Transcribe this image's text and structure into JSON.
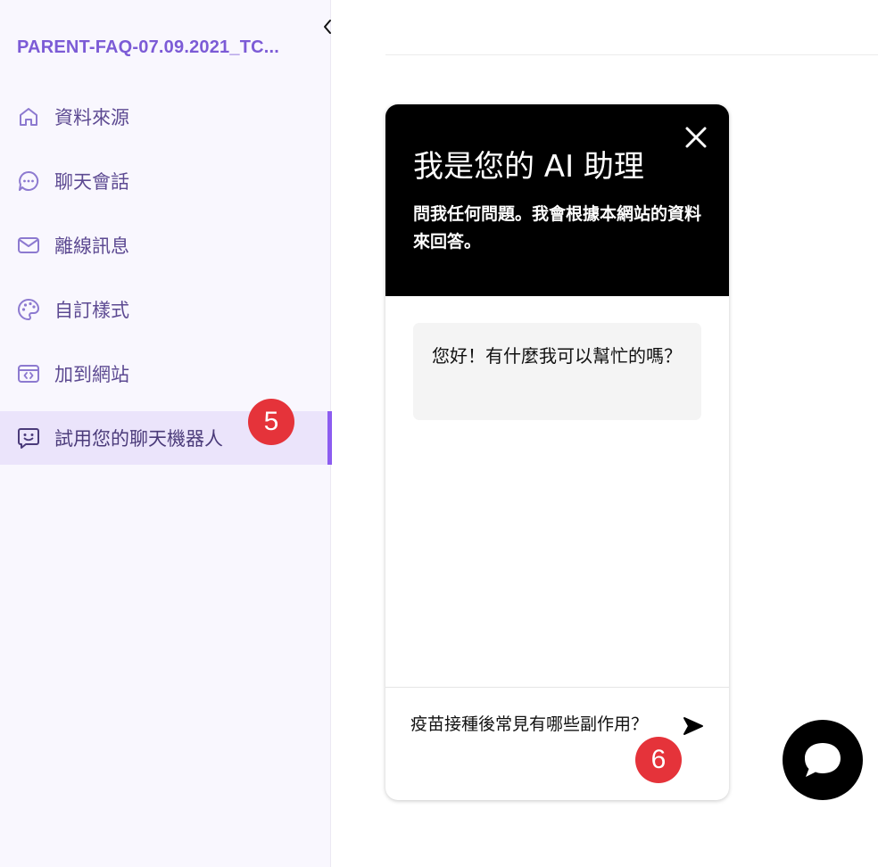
{
  "sidebar": {
    "project_title": "PARENT-FAQ-07.09.2021_TC...",
    "items": [
      {
        "label": "資料來源",
        "icon": "home-icon"
      },
      {
        "label": "聊天會話",
        "icon": "chat-dots-icon"
      },
      {
        "label": "離線訊息",
        "icon": "mail-icon"
      },
      {
        "label": "自訂樣式",
        "icon": "palette-icon"
      },
      {
        "label": "加到網站",
        "icon": "code-window-icon"
      },
      {
        "label": "試用您的聊天機器人",
        "icon": "bot-message-icon",
        "active": true
      }
    ],
    "collapse_icon": "chevron-left-icon"
  },
  "step_badges": {
    "first": "5",
    "second": "6"
  },
  "chat": {
    "title": "我是您的 AI 助理",
    "subtitle": "問我任何問題。我會根據本網站的資料來回答。",
    "greeting": "您好！有什麼我可以幫忙的嗎？",
    "input_value": "疫苗接種後常見有哪些副作用？",
    "close_icon": "close-icon",
    "send_icon": "send-icon"
  },
  "launcher": {
    "icon": "chat-bubble-icon"
  },
  "colors": {
    "accent": "#8c5cf0",
    "title_purple": "#7c5bd6",
    "badge_red": "#e5333a",
    "header_black": "#000000"
  }
}
